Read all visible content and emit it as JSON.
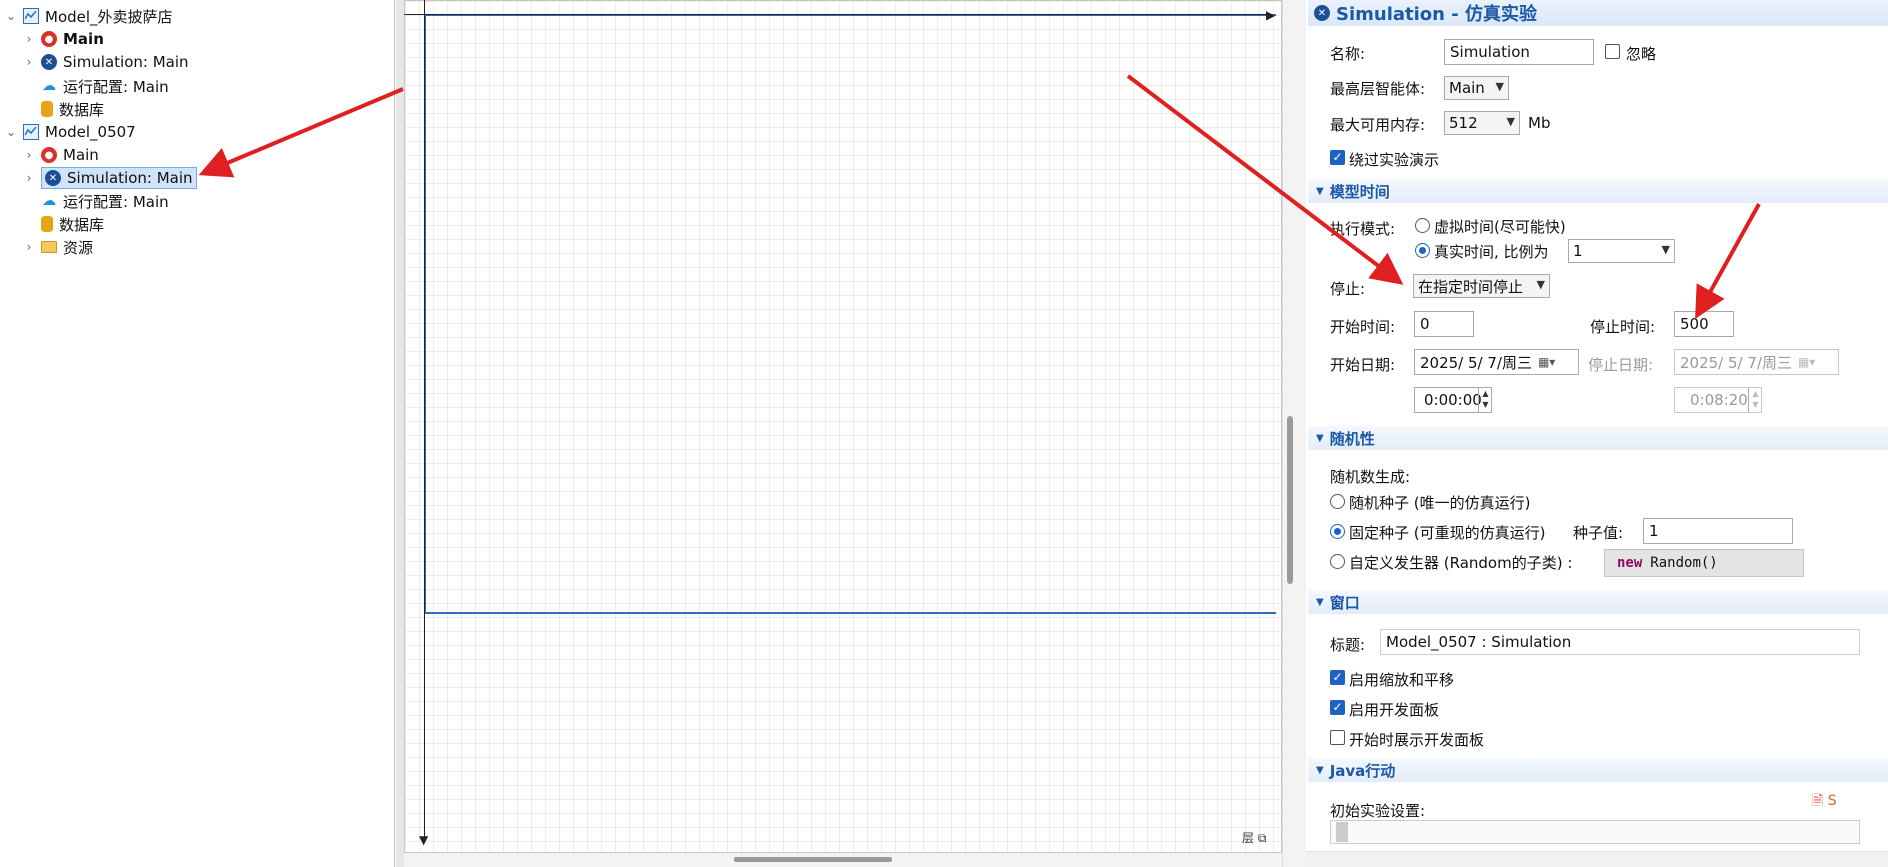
{
  "tree": {
    "items": [
      {
        "label": "Model_外卖披萨店",
        "icon": "model-icon",
        "chevron": "⌄"
      },
      {
        "label": "Main",
        "icon": "agent-icon",
        "chevron": "›"
      },
      {
        "label": "Simulation: Main",
        "icon": "simulation-icon",
        "chevron": "›"
      },
      {
        "label": "运行配置: Main",
        "icon": "run-config-icon"
      },
      {
        "label": "数据库",
        "icon": "database-icon"
      },
      {
        "label": "Model_0507",
        "icon": "model-icon",
        "chevron": "⌄"
      },
      {
        "label": "Main",
        "icon": "agent-icon",
        "chevron": "›"
      },
      {
        "label": "Simulation: Main",
        "icon": "simulation-icon",
        "chevron": "›"
      },
      {
        "label": "运行配置: Main",
        "icon": "run-config-icon"
      },
      {
        "label": "数据库",
        "icon": "database-icon"
      },
      {
        "label": "资源",
        "icon": "folder-icon",
        "chevron": "›"
      }
    ]
  },
  "canvas": {
    "layers_label": "层"
  },
  "props": {
    "title": "Simulation - 仿真实验",
    "name_label": "名称:",
    "name_value": "Simulation",
    "ignore_label": "忽略",
    "top_agent_label": "最高层智能体:",
    "top_agent_value": "Main",
    "max_memory_label": "最大可用内存:",
    "max_memory_value": "512",
    "max_memory_unit": "Mb",
    "skip_demo_label": "绕过实验演示",
    "model_time": {
      "section": "模型时间",
      "exec_mode_label": "执行模式:",
      "virtual_label": "虚拟时间(尽可能快)",
      "real_label": "真实时间, 比例为",
      "real_scale": "1",
      "stop_label": "停止:",
      "stop_value": "在指定时间停止",
      "start_time_label": "开始时间:",
      "start_time_value": "0",
      "stop_time_label": "停止时间:",
      "stop_time_value": "500",
      "start_date_label": "开始日期:",
      "start_date_value": "2025/ 5/ 7/周三",
      "stop_date_label": "停止日期:",
      "stop_date_value": "2025/ 5/ 7/周三",
      "start_clock": "0:00:00",
      "stop_clock": "0:08:20"
    },
    "randomness": {
      "section": "随机性",
      "rng_label": "随机数生成:",
      "random_seed_label": "随机种子 (唯一的仿真运行)",
      "fixed_seed_label": "固定种子 (可重现的仿真运行)",
      "seed_value_label": "种子值:",
      "seed_value": "1",
      "custom_label": "自定义发生器 (Random的子类) :",
      "code_keyword": "new",
      "code_rest": "Random()"
    },
    "window": {
      "section": "窗口",
      "title_label": "标题:",
      "title_value": "Model_0507 : Simulation",
      "zoom_pan_label": "启用缩放和平移",
      "dev_panel_label": "启用开发面板",
      "show_dev_panel_label": "开始时展示开发面板"
    },
    "java": {
      "section": "Java行动",
      "initial_setup_label": "初始实验设置:"
    }
  },
  "colors": {
    "accent": "#1d58a8",
    "selection": "#cfe3fb",
    "annotation": "#e02020",
    "frame": "#2e6fb8"
  }
}
